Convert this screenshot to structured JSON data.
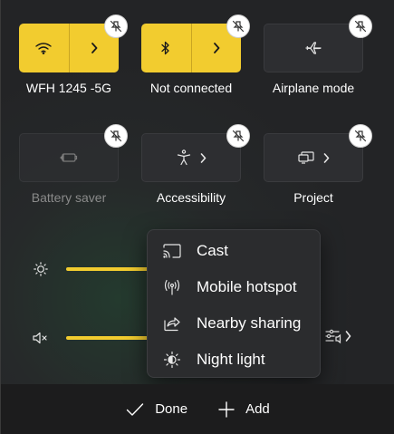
{
  "tiles": {
    "wifi": {
      "label": "WFH 1245 -5G",
      "icon": "wifi-icon",
      "state": "on"
    },
    "bluetooth": {
      "label": "Not connected",
      "icon": "bluetooth-icon",
      "state": "on"
    },
    "airplane": {
      "label": "Airplane mode",
      "icon": "airplane-icon",
      "state": "off"
    },
    "battery_saver": {
      "label": "Battery saver",
      "icon": "battery-saver-icon",
      "state": "disabled"
    },
    "accessibility": {
      "label": "Accessibility",
      "icon": "accessibility-icon",
      "state": "off"
    },
    "project": {
      "label": "Project",
      "icon": "project-icon",
      "state": "off"
    }
  },
  "sliders": {
    "brightness": {
      "icon": "sun-icon",
      "level": 1.0
    },
    "volume": {
      "icon": "speaker-muted-icon",
      "level": 1.0
    }
  },
  "add_menu": {
    "items": [
      {
        "label": "Cast",
        "icon": "cast-icon"
      },
      {
        "label": "Mobile hotspot",
        "icon": "hotspot-icon"
      },
      {
        "label": "Nearby sharing",
        "icon": "share-icon"
      },
      {
        "label": "Night light",
        "icon": "night-light-icon"
      }
    ]
  },
  "footer": {
    "done_label": "Done",
    "add_label": "Add"
  },
  "colors": {
    "accent": "#f2cc2f",
    "panel": "#232426",
    "menu": "#2b2c2e",
    "footer": "#1c1c1d"
  }
}
